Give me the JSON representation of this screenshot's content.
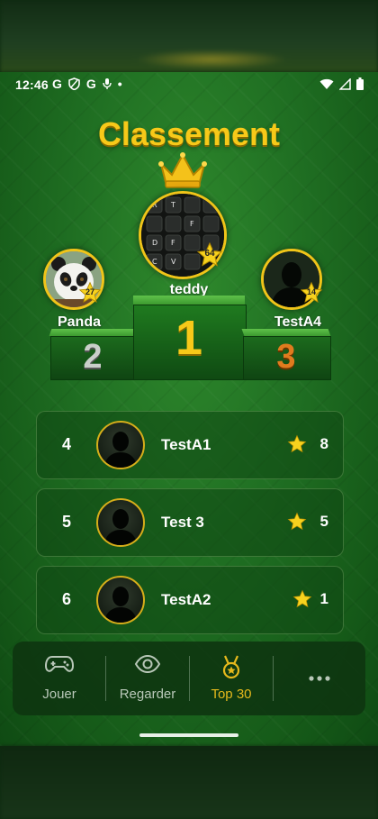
{
  "status_bar": {
    "time": "12:46",
    "app_icons": [
      "G",
      "shield-icon",
      "G",
      "mic-off-icon",
      "•"
    ]
  },
  "title": "Classement",
  "podium": {
    "first": {
      "name": "teddy",
      "score": "64",
      "rank": "1",
      "avatar": "keyboard-photo"
    },
    "second": {
      "name": "Panda",
      "score": "27",
      "rank": "2",
      "avatar": "panda-photo"
    },
    "third": {
      "name": "TestA4",
      "score": "14",
      "rank": "3",
      "avatar": "silhouette"
    }
  },
  "rankings": [
    {
      "rank": "4",
      "name": "TestA1",
      "score": "8"
    },
    {
      "rank": "5",
      "name": "Test 3",
      "score": "5"
    },
    {
      "rank": "6",
      "name": "TestA2",
      "score": "1"
    }
  ],
  "nav": {
    "items": [
      {
        "label": "Jouer",
        "icon": "gamepad-icon",
        "active": false
      },
      {
        "label": "Regarder",
        "icon": "eye-icon",
        "active": false
      },
      {
        "label": "Top 30",
        "icon": "medal-icon",
        "active": true
      },
      {
        "label": "",
        "icon": "more-icon",
        "active": false
      }
    ]
  },
  "colors": {
    "gold": "#f7c919",
    "active_tab": "#e6b91c",
    "inactive_tab": "#b8c7b8"
  }
}
